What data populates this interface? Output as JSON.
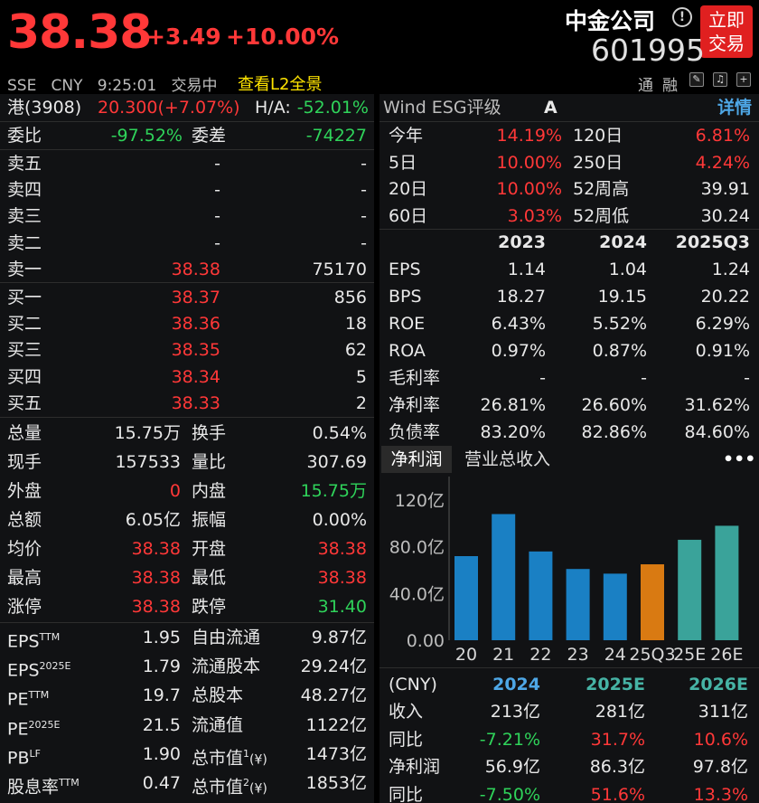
{
  "header": {
    "price": "38.38",
    "change": "+3.49",
    "change_pct": "+10.00%",
    "name": "中金公司",
    "code": "601995",
    "trade_button": "立即\n交易",
    "trade_line1": "立即",
    "trade_line2": "交易",
    "exchange": "SSE",
    "currency": "CNY",
    "time": "9:25:01",
    "status": "交易中",
    "l2_link": "查看L2全景",
    "tong": "通",
    "rong": "融",
    "info_icon": "!"
  },
  "left": {
    "hk": {
      "label": "港(3908)",
      "price": "20.300(+7.07%)",
      "ha_label": "H/A:",
      "ha_value": "-52.01%"
    },
    "wei": {
      "label1": "委比",
      "value1": "-97.52%",
      "label2": "委差",
      "value2": "-74227"
    },
    "asks": [
      {
        "label": "卖五",
        "price": "-",
        "vol": "-"
      },
      {
        "label": "卖四",
        "price": "-",
        "vol": "-"
      },
      {
        "label": "卖三",
        "price": "-",
        "vol": "-"
      },
      {
        "label": "卖二",
        "price": "-",
        "vol": "-"
      },
      {
        "label": "卖一",
        "price": "38.38",
        "vol": "75170"
      }
    ],
    "bids": [
      {
        "label": "买一",
        "price": "38.37",
        "vol": "856"
      },
      {
        "label": "买二",
        "price": "38.36",
        "vol": "18"
      },
      {
        "label": "买三",
        "price": "38.35",
        "vol": "62"
      },
      {
        "label": "买四",
        "price": "38.34",
        "vol": "5"
      },
      {
        "label": "买五",
        "price": "38.33",
        "vol": "2"
      }
    ],
    "stats": [
      {
        "l1": "总量",
        "v1": "15.75万",
        "c1": "white",
        "l2": "换手",
        "v2": "0.54%",
        "c2": "white"
      },
      {
        "l1": "现手",
        "v1": "157533",
        "c1": "white",
        "l2": "量比",
        "v2": "307.69",
        "c2": "white"
      },
      {
        "l1": "外盘",
        "v1": "0",
        "c1": "red",
        "l2": "内盘",
        "v2": "15.75万",
        "c2": "green"
      },
      {
        "l1": "总额",
        "v1": "6.05亿",
        "c1": "white",
        "l2": "振幅",
        "v2": "0.00%",
        "c2": "white"
      },
      {
        "l1": "均价",
        "v1": "38.38",
        "c1": "red",
        "l2": "开盘",
        "v2": "38.38",
        "c2": "red"
      },
      {
        "l1": "最高",
        "v1": "38.38",
        "c1": "red",
        "l2": "最低",
        "v2": "38.38",
        "c2": "red"
      },
      {
        "l1": "涨停",
        "v1": "38.38",
        "c1": "red",
        "l2": "跌停",
        "v2": "31.40",
        "c2": "green"
      }
    ],
    "valuation": [
      {
        "l1": "EPS",
        "s1": "TTM",
        "v1": "1.95",
        "l2": "自由流通",
        "v2": "9.87亿"
      },
      {
        "l1": "EPS",
        "s1": "2025E",
        "v1": "1.79",
        "l2": "流通股本",
        "v2": "29.24亿"
      },
      {
        "l1": "PE",
        "s1": "TTM",
        "v1": "19.7",
        "l2": "总股本",
        "v2": "48.27亿"
      },
      {
        "l1": "PE",
        "s1": "2025E",
        "v1": "21.5",
        "l2": "流通值",
        "v2": "1122亿"
      },
      {
        "l1": "PB",
        "s1": "LF",
        "v1": "1.90",
        "l2": "总市值",
        "s2": "1",
        "sym2": "(¥)",
        "v2": "1473亿"
      },
      {
        "l1": "股息率",
        "s1": "TTM",
        "v1": "0.47",
        "l2": "总市值",
        "s2": "2",
        "sym2": "(¥)",
        "v2": "1853亿"
      }
    ]
  },
  "right": {
    "esg": {
      "label": "Wind ESG评级",
      "grade": "A",
      "detail": "详情"
    },
    "returns": [
      {
        "l1": "今年",
        "v1": "14.19%",
        "c1": "red",
        "l2": "120日",
        "v2": "6.81%",
        "c2": "red"
      },
      {
        "l1": "5日",
        "v1": "10.00%",
        "c1": "red",
        "l2": "250日",
        "v2": "4.24%",
        "c2": "red"
      },
      {
        "l1": "20日",
        "v1": "10.00%",
        "c1": "red",
        "l2": "52周高",
        "v2": "39.91",
        "c2": "white"
      },
      {
        "l1": "60日",
        "v1": "3.03%",
        "c1": "red",
        "l2": "52周低",
        "v2": "30.24",
        "c2": "white"
      }
    ],
    "fin_header": [
      "2023",
      "2024",
      "2025Q3"
    ],
    "fin_rows": [
      {
        "label": "EPS",
        "values": [
          "1.14",
          "1.04",
          "1.24"
        ]
      },
      {
        "label": "BPS",
        "values": [
          "18.27",
          "19.15",
          "20.22"
        ]
      },
      {
        "label": "ROE",
        "values": [
          "6.43%",
          "5.52%",
          "6.29%"
        ]
      },
      {
        "label": "ROA",
        "values": [
          "0.97%",
          "0.87%",
          "0.91%"
        ]
      },
      {
        "label": "毛利率",
        "values": [
          "-",
          "-",
          "-"
        ]
      },
      {
        "label": "净利率",
        "values": [
          "26.81%",
          "26.60%",
          "31.62%"
        ]
      },
      {
        "label": "负债率",
        "values": [
          "83.20%",
          "82.86%",
          "84.60%"
        ]
      }
    ],
    "tabs": {
      "active": "净利润",
      "other": "营业总收入",
      "more": "•••"
    },
    "forecast": {
      "header": [
        "(CNY)",
        "2024",
        "2025E",
        "2026E"
      ],
      "rows": [
        {
          "label": "收入",
          "values": [
            "213亿",
            "281亿",
            "311亿"
          ],
          "colors": [
            "white",
            "white",
            "white"
          ]
        },
        {
          "label": "同比",
          "values": [
            "-7.21%",
            "31.7%",
            "10.6%"
          ],
          "colors": [
            "green",
            "red",
            "red"
          ]
        },
        {
          "label": "净利润",
          "values": [
            "56.9亿",
            "86.3亿",
            "97.8亿"
          ],
          "colors": [
            "white",
            "white",
            "white"
          ]
        },
        {
          "label": "同比",
          "values": [
            "-7.50%",
            "51.6%",
            "13.3%"
          ],
          "colors": [
            "green",
            "red",
            "red"
          ]
        }
      ]
    }
  },
  "chart_data": {
    "type": "bar",
    "categories": [
      "20",
      "21",
      "22",
      "23",
      "24",
      "25Q3",
      "25E",
      "26E"
    ],
    "values": [
      72,
      108,
      76,
      61,
      57,
      65,
      86,
      98
    ],
    "bar_colors": [
      "#1a80c4",
      "#1a80c4",
      "#1a80c4",
      "#1a80c4",
      "#1a80c4",
      "#d97a12",
      "#3aa39a",
      "#3aa39a"
    ],
    "yticks": [
      "120亿",
      "80.0亿",
      "40.0亿",
      "0.00"
    ],
    "ytick_values": [
      120,
      80,
      40,
      0
    ],
    "ylim": [
      0,
      130
    ],
    "grid": false
  }
}
